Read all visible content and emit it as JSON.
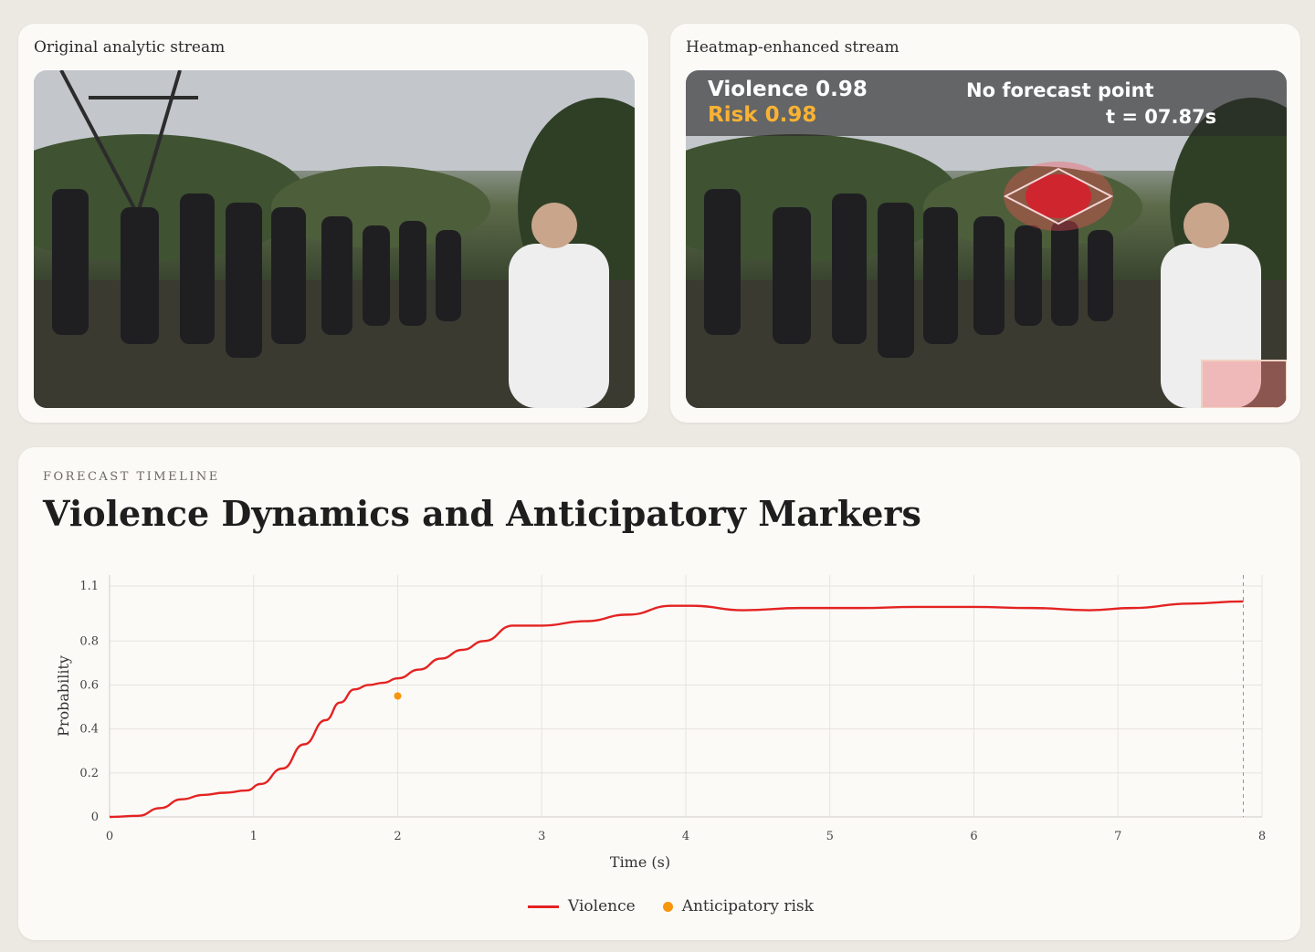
{
  "panels": {
    "original": {
      "title": "Original analytic stream"
    },
    "heatmap": {
      "title": "Heatmap-enhanced stream",
      "violence_text": "Violence 0.98",
      "risk_text": "Risk 0.98",
      "forecast_text": "No forecast point",
      "time_text": "t = 07.87s"
    }
  },
  "timeline": {
    "eyebrow": "FORECAST TIMELINE",
    "title": "Violence Dynamics and Anticipatory Markers"
  },
  "colors": {
    "violence": "#e32322",
    "risk": "#f7950d",
    "overlay_risk_text": "#f9b233"
  },
  "chart_data": {
    "type": "line",
    "xlabel": "Time (s)",
    "ylabel": "Probability",
    "xlim": [
      0,
      8
    ],
    "ylim": [
      0,
      1.1
    ],
    "xticks": [
      "0",
      "1",
      "2",
      "3",
      "4",
      "5",
      "6",
      "7",
      "8"
    ],
    "yticks": [
      "0",
      "0.2",
      "0.4",
      "0.6",
      "0.8",
      "1.1"
    ],
    "ytick_values": [
      0,
      0.2,
      0.4,
      0.6,
      0.8,
      1.05
    ],
    "grid": true,
    "legend_placement": "bottom-center",
    "series": [
      {
        "name": "Violence",
        "x": [
          0,
          0.2,
          0.35,
          0.5,
          0.65,
          0.8,
          0.95,
          1.05,
          1.2,
          1.35,
          1.5,
          1.6,
          1.7,
          1.8,
          1.9,
          2.0,
          2.15,
          2.3,
          2.45,
          2.6,
          2.8,
          3.0,
          3.3,
          3.6,
          3.9,
          4.05,
          4.4,
          4.8,
          5.2,
          5.6,
          6.0,
          6.4,
          6.8,
          7.1,
          7.5,
          7.87
        ],
        "y": [
          0,
          0.005,
          0.04,
          0.08,
          0.1,
          0.11,
          0.12,
          0.15,
          0.22,
          0.33,
          0.44,
          0.52,
          0.58,
          0.6,
          0.61,
          0.63,
          0.67,
          0.72,
          0.76,
          0.8,
          0.87,
          0.87,
          0.89,
          0.92,
          0.96,
          0.96,
          0.94,
          0.95,
          0.95,
          0.955,
          0.955,
          0.95,
          0.94,
          0.95,
          0.97,
          0.98
        ]
      },
      {
        "name": "Anticipatory risk",
        "x": [
          2.0
        ],
        "y": [
          0.55
        ]
      }
    ],
    "marker_line_x": 7.87
  }
}
